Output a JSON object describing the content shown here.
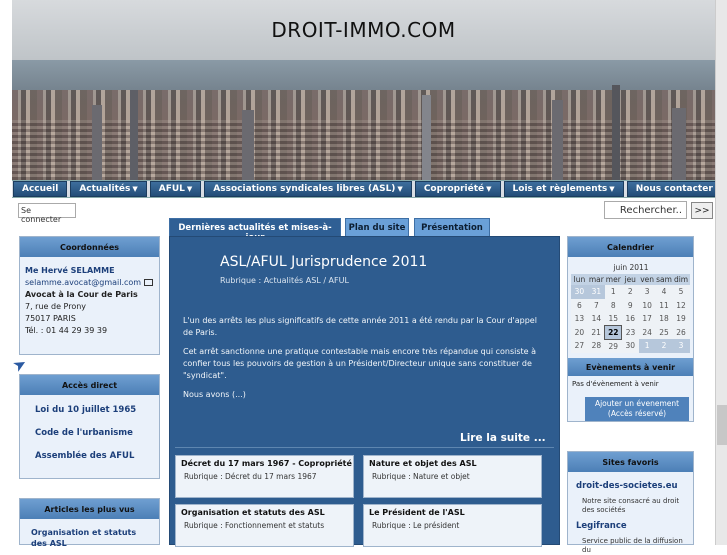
{
  "site": {
    "title": "DROIT-IMMO.COM"
  },
  "nav": [
    {
      "label": "Accueil",
      "has_menu": false
    },
    {
      "label": "Actualités",
      "has_menu": true
    },
    {
      "label": "AFUL",
      "has_menu": true
    },
    {
      "label": "Associations syndicales libres (ASL)",
      "has_menu": true
    },
    {
      "label": "Copropriété",
      "has_menu": true
    },
    {
      "label": "Lois et règlements",
      "has_menu": true
    },
    {
      "label": "Nous contacter",
      "has_menu": false
    }
  ],
  "nav_arrow": "▼",
  "login": {
    "label": "Se connecter"
  },
  "search": {
    "placeholder": "Rechercher..",
    "button": ">>"
  },
  "coordonnees": {
    "title": "Coordonnées",
    "name": "Me Hervé SELAMME",
    "email": "selamme.avocat@gmail.com",
    "role": "Avocat à la Cour de Paris",
    "address1": "7, rue de Prony",
    "address2": "75017 PARIS",
    "phone": "Tél. : 01 44 29 39 39"
  },
  "acces": {
    "title": "Accès direct",
    "items": [
      "Loi du 10 juillet 1965",
      "Code de l'urbanisme",
      "Assemblée des AFUL"
    ]
  },
  "articles_plus_vus": {
    "title": "Articles les plus vus",
    "items": [
      "Organisation et statuts des ASL"
    ]
  },
  "tabs": [
    {
      "label": "Dernières actualités et mises-à-jour",
      "active": true
    },
    {
      "label": "Plan du site",
      "active": false
    },
    {
      "label": "Présentation",
      "active": false
    }
  ],
  "article": {
    "title": "ASL/AFUL Jurisprudence 2011",
    "rubrique": "Rubrique : Actualités ASL / AFUL",
    "para1": "L'un des arrêts les plus significatifs de cette année 2011 a été rendu par la Cour d'appel de Paris.",
    "para2": "Cet arrêt sanctionne une pratique contestable mais encore très répandue qui consiste à confier tous les pouvoirs de gestion à un Président/Directeur unique sans constituer de \"syndicat\".",
    "para3": "Nous avons (...)",
    "read_more": "Lire la suite ..."
  },
  "cards": [
    {
      "title": "Décret du 17 mars 1967 - Copropriété",
      "rubrique": "Rubrique : Décret du 17 mars 1967"
    },
    {
      "title": "Nature et objet des ASL",
      "rubrique": "Rubrique : Nature et objet"
    },
    {
      "title": "Organisation et statuts des ASL",
      "rubrique": "Rubrique : Fonctionnement et statuts"
    },
    {
      "title": "Le Président de l'ASL",
      "rubrique": "Rubrique : Le président"
    }
  ],
  "calendar": {
    "title": "Calendrier",
    "month": "juin 2011",
    "days": [
      "lun",
      "mar",
      "mer",
      "jeu",
      "ven",
      "sam",
      "dim"
    ],
    "weeks": [
      [
        "30",
        "31",
        "1",
        "2",
        "3",
        "4",
        "5"
      ],
      [
        "6",
        "7",
        "8",
        "9",
        "10",
        "11",
        "12"
      ],
      [
        "13",
        "14",
        "15",
        "16",
        "17",
        "18",
        "19"
      ],
      [
        "20",
        "21",
        "22",
        "23",
        "24",
        "25",
        "26"
      ],
      [
        "27",
        "28",
        "29",
        "30",
        "1",
        "2",
        "3"
      ]
    ],
    "today": "22"
  },
  "evenements": {
    "title": "Evènements à venir",
    "empty": "Pas d'évènement à venir",
    "add_button": "Ajouter un évenement (Accès réservé)"
  },
  "favoris": {
    "title": "Sites favoris",
    "items": [
      {
        "name": "droit-des-societes.eu",
        "desc": "Notre site consacré au droit des sociétés"
      },
      {
        "name": "Legifrance",
        "desc": "Service public de la diffusion du"
      }
    ]
  }
}
